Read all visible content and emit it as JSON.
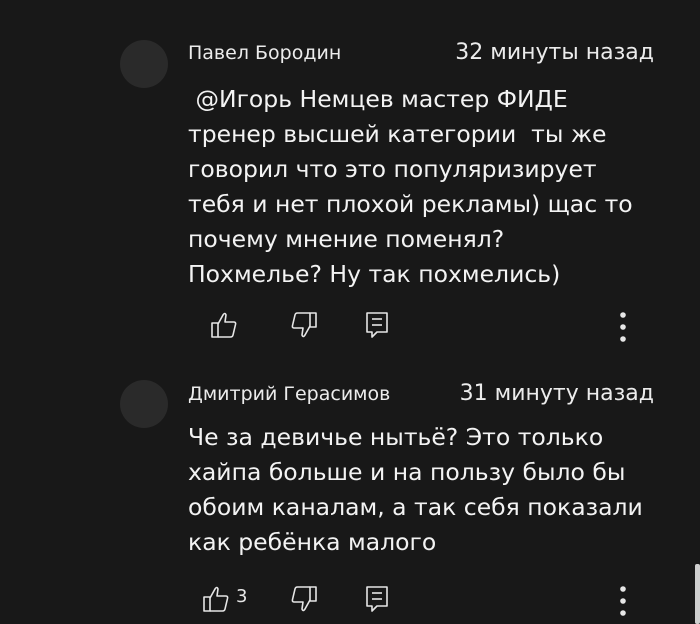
{
  "comments": [
    {
      "author": "Павел Бородин",
      "time": "32 минуты назад",
      "text": " @Игорь Немцев мастер ФИДЕ\nтренер высшей категории  ты же\nговорил что это популяризирует\nтебя и нет плохой рекламы) щас то\nпочему мнение поменял?\nПохмелье? Ну так похмелись)",
      "like_count": ""
    },
    {
      "author": "Дмитрий Герасимов",
      "time": "31 минуту назад",
      "text": "Че за девичье нытьё? Это только\nхайпа больше и на пользу было бы\nобоим каналам, а так себя показали\nкак ребёнка малого",
      "like_count": "3"
    }
  ],
  "icons": {
    "like": "thumbs-up-icon",
    "dislike": "thumbs-down-icon",
    "reply": "reply-icon",
    "more": "more-vertical-icon"
  },
  "colors": {
    "background": "#181818",
    "text": "#f1f1f1",
    "avatar": "#2a2a2a"
  }
}
